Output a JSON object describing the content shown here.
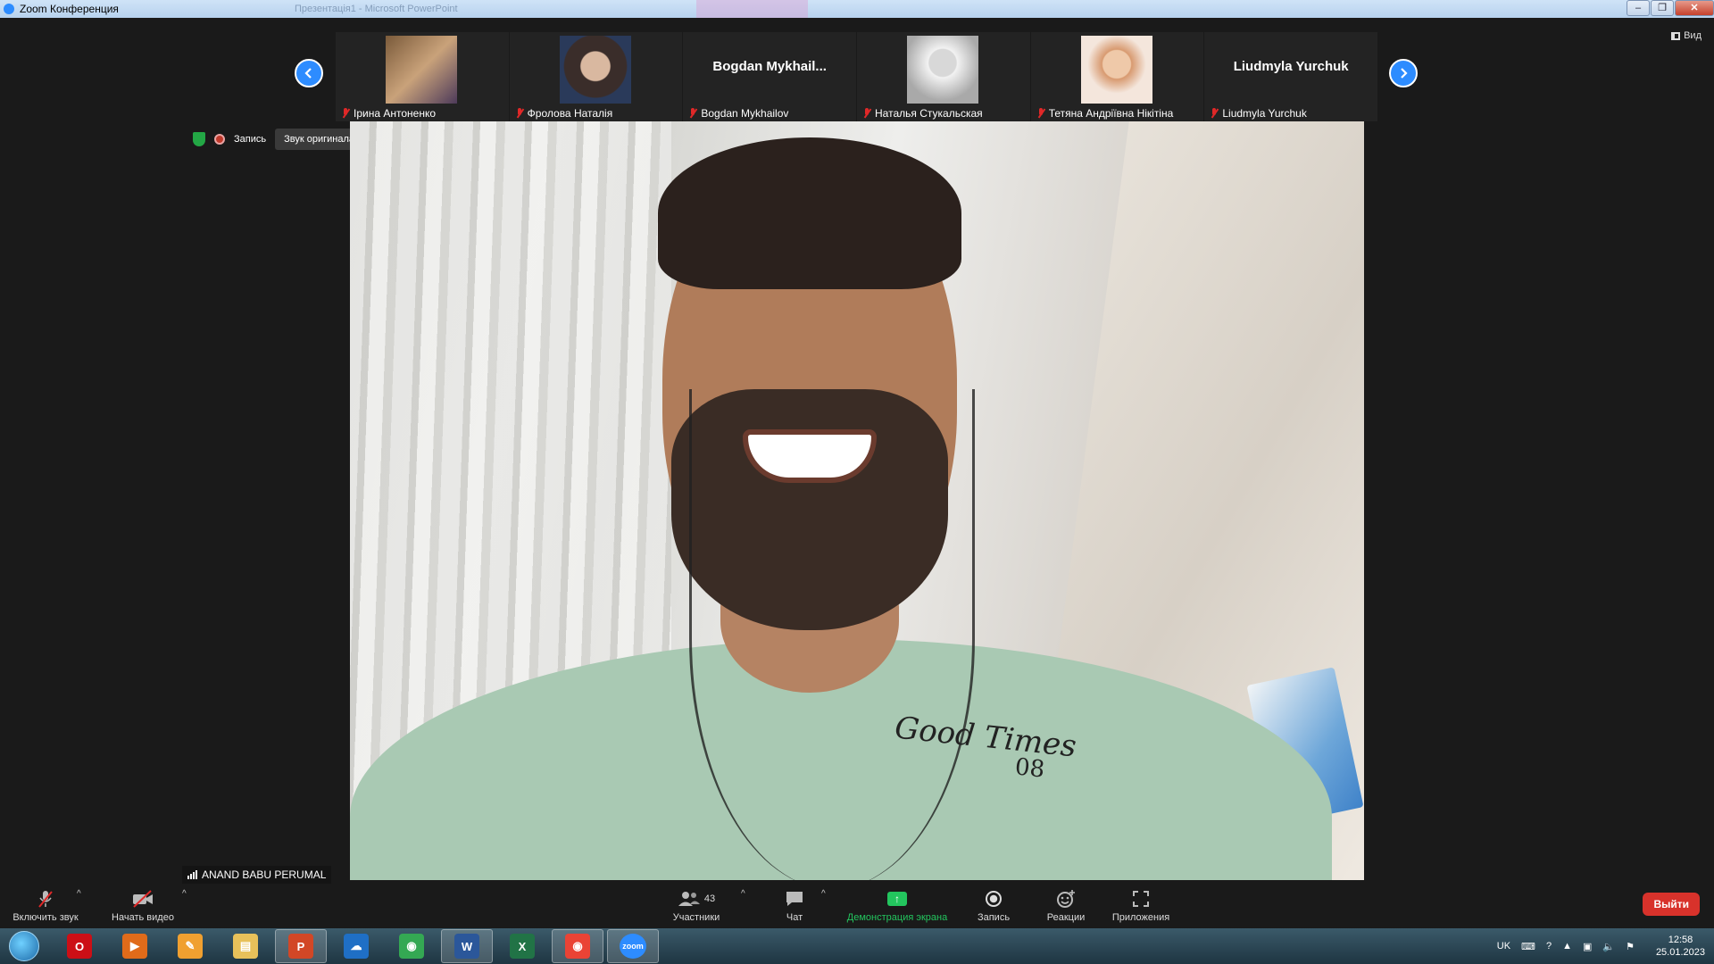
{
  "window": {
    "title": "Zoom Конференция",
    "background_ghost": "Презентація1 - Microsoft PowerPoint"
  },
  "view_button": {
    "label": "Вид"
  },
  "gallery": [
    {
      "name": "Ірина Антоненко",
      "has_photo": true,
      "photo_colors": [
        "#7a5a3a",
        "#c9a27a"
      ]
    },
    {
      "name": "Фролова Наталія",
      "has_photo": true,
      "photo_colors": [
        "#3a2d2a",
        "#d9b8a0"
      ]
    },
    {
      "name": "Bogdan Mykhailov",
      "has_photo": false,
      "display": "Bogdan  Mykhail..."
    },
    {
      "name": "Наталья Стукальская",
      "has_photo": true,
      "photo_colors": [
        "#e8e8e8",
        "#a9a9a9"
      ]
    },
    {
      "name": "Тетяна Андріївна Нікітіна",
      "has_photo": true,
      "photo_colors": [
        "#f4e6dc",
        "#d89a70"
      ]
    },
    {
      "name": "Liudmyla Yurchuk",
      "has_photo": false,
      "display": "Liudmyla Yurchuk"
    }
  ],
  "status": {
    "recording_label": "Запись",
    "tooltip": "Звук оригинала для музыкантов выключен"
  },
  "active_speaker": {
    "name": "ANAND BABU PERUMAL",
    "shirt_text_line1": "Good Times",
    "shirt_text_line2": "08"
  },
  "controls": {
    "mute": "Включить звук",
    "video": "Начать видео",
    "participants": "Участники",
    "participants_count": "43",
    "chat": "Чат",
    "share": "Демонстрация экрана",
    "record": "Запись",
    "reactions": "Реакции",
    "apps": "Приложения",
    "leave": "Выйти"
  },
  "taskbar": {
    "apps": [
      {
        "name": "opera",
        "color": "#cc0f16",
        "glyph": "O"
      },
      {
        "name": "media-player",
        "color": "#e06b1a",
        "glyph": "▶"
      },
      {
        "name": "paint",
        "color": "#f0a030",
        "glyph": "✎"
      },
      {
        "name": "file-explorer",
        "color": "#e8c15a",
        "glyph": "▤"
      },
      {
        "name": "powerpoint",
        "color": "#d24726",
        "glyph": "P"
      },
      {
        "name": "onedrive",
        "color": "#1f6fc5",
        "glyph": "☁"
      },
      {
        "name": "chrome",
        "color": "#34a853",
        "glyph": "◉"
      },
      {
        "name": "word",
        "color": "#2b579a",
        "glyph": "W"
      },
      {
        "name": "excel",
        "color": "#217346",
        "glyph": "X"
      },
      {
        "name": "chrome-2",
        "color": "#ea4335",
        "glyph": "◉"
      },
      {
        "name": "zoom",
        "color": "#2d8cff",
        "glyph": "zoom"
      }
    ],
    "language": "UK",
    "time": "12:58",
    "date": "25.01.2023"
  }
}
